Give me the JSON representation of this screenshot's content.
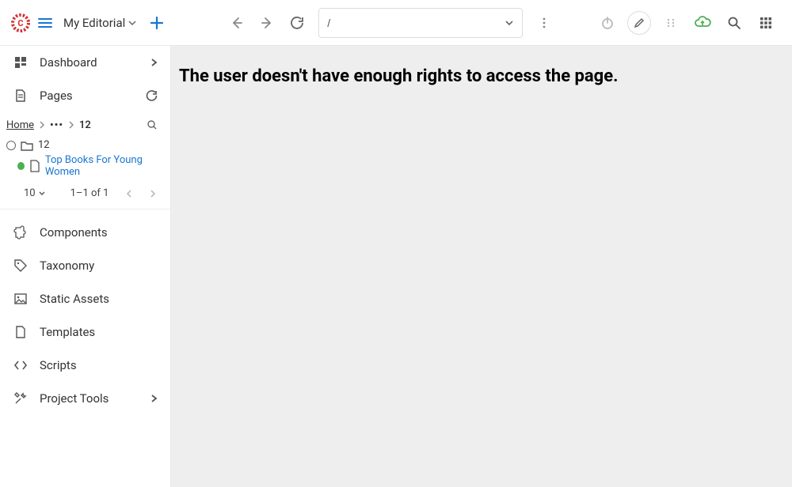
{
  "header": {
    "workspace_label": "My Editorial",
    "url_value": "/"
  },
  "sidebar": {
    "dashboard_label": "Dashboard",
    "pages_label": "Pages",
    "breadcrumb": {
      "home": "Home",
      "current": "12"
    },
    "tree": {
      "folder_label": "12",
      "page_label": "Top Books For Young Women"
    },
    "pager": {
      "pagesize": "10",
      "range": "1–1 of 1"
    },
    "components_label": "Components",
    "taxonomy_label": "Taxonomy",
    "static_assets_label": "Static Assets",
    "templates_label": "Templates",
    "scripts_label": "Scripts",
    "project_tools_label": "Project Tools"
  },
  "content": {
    "message": "The user doesn't have enough rights to access the page."
  }
}
